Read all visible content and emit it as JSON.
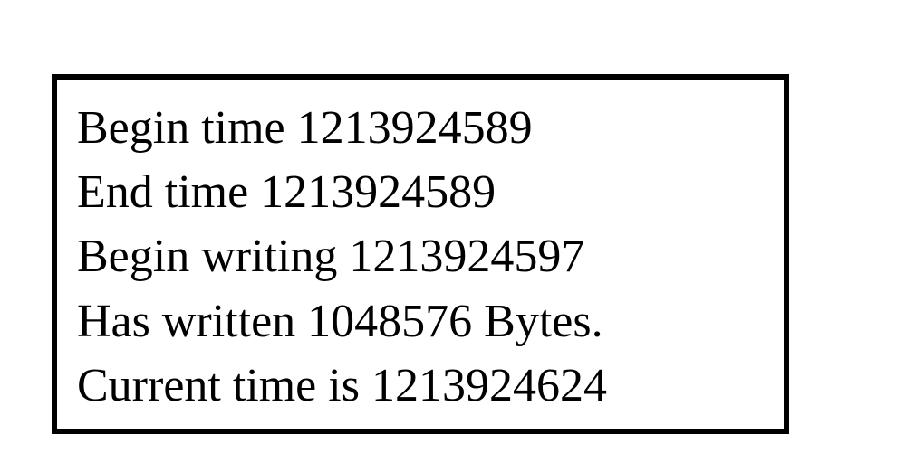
{
  "log": {
    "line1": "Begin time 1213924589",
    "line2": "End time 1213924589",
    "line3": "Begin writing 1213924597",
    "line4": "Has written 1048576 Bytes.",
    "line5": "Current time is 1213924624"
  }
}
